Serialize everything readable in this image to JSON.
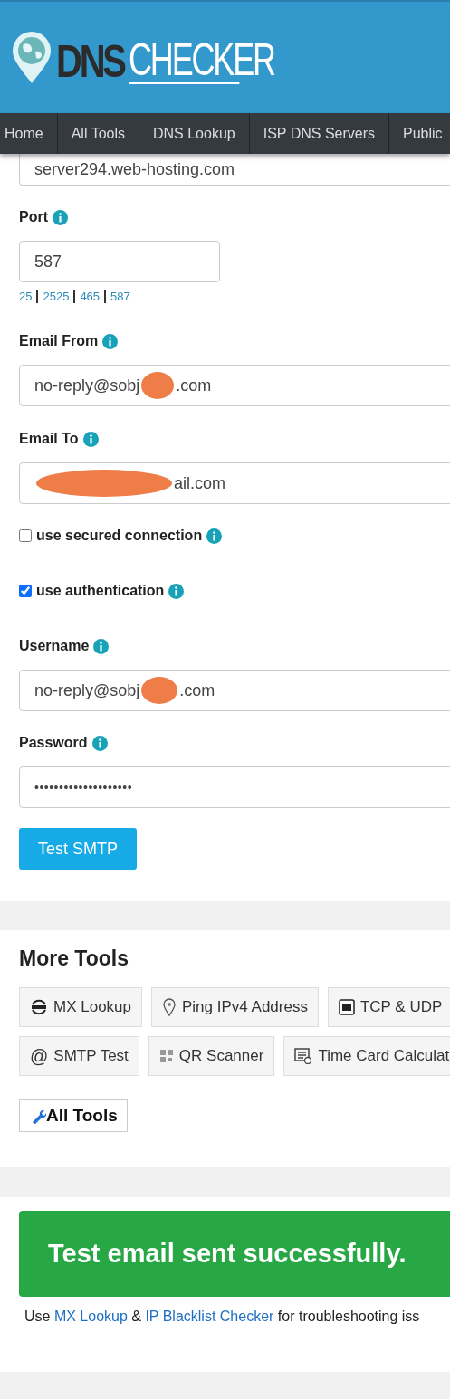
{
  "logo": {
    "part_1": "DNS",
    "part_2": "CHECKER"
  },
  "nav": [
    {
      "label": "Home"
    },
    {
      "label": "All Tools"
    },
    {
      "label": "DNS Lookup"
    },
    {
      "label": "ISP DNS Servers"
    },
    {
      "label": "Public"
    }
  ],
  "form": {
    "server_value": "server294.web-hosting.com",
    "port": {
      "label": "Port",
      "value": "587",
      "presets": [
        "25",
        "2525",
        "465",
        "587"
      ]
    },
    "email_from": {
      "label": "Email From",
      "value_start": "no-reply@sobj",
      "value_end": ".com",
      "redacted": true
    },
    "email_to": {
      "label": "Email To",
      "value_end": "ail.com",
      "redacted": true
    },
    "options": [
      {
        "label": "use secured connection",
        "checked": false
      },
      {
        "label": "use authentication",
        "checked": true
      }
    ],
    "username": {
      "label": "Username",
      "value_start": "no-reply@sobj",
      "value_end": ".com",
      "redacted": true
    },
    "password": {
      "label": "Password",
      "value": "••••••••••••••••••••"
    },
    "submit": "Test SMTP"
  },
  "more_tools": {
    "title": "More Tools",
    "rows": [
      [
        {
          "kind": "dns",
          "label": "MX Lookup"
        },
        {
          "kind": "pin",
          "label": "Ping IPv4 Address"
        },
        {
          "kind": "port",
          "label": "TCP & UDP"
        }
      ],
      [
        {
          "kind": "at",
          "glyph": "@",
          "label": "SMTP Test"
        },
        {
          "kind": "qr",
          "label": "QR Scanner"
        },
        {
          "kind": "timecard",
          "label": "Time Card Calculat"
        }
      ]
    ],
    "all_tools": "All Tools"
  },
  "result": {
    "message": "Test email sent successfully.",
    "hint_start": "Use ",
    "link_1": "MX Lookup",
    "hint_mid": " & ",
    "link_2": "IP Blacklist Checker",
    "hint_end": " for troubleshooting iss"
  }
}
